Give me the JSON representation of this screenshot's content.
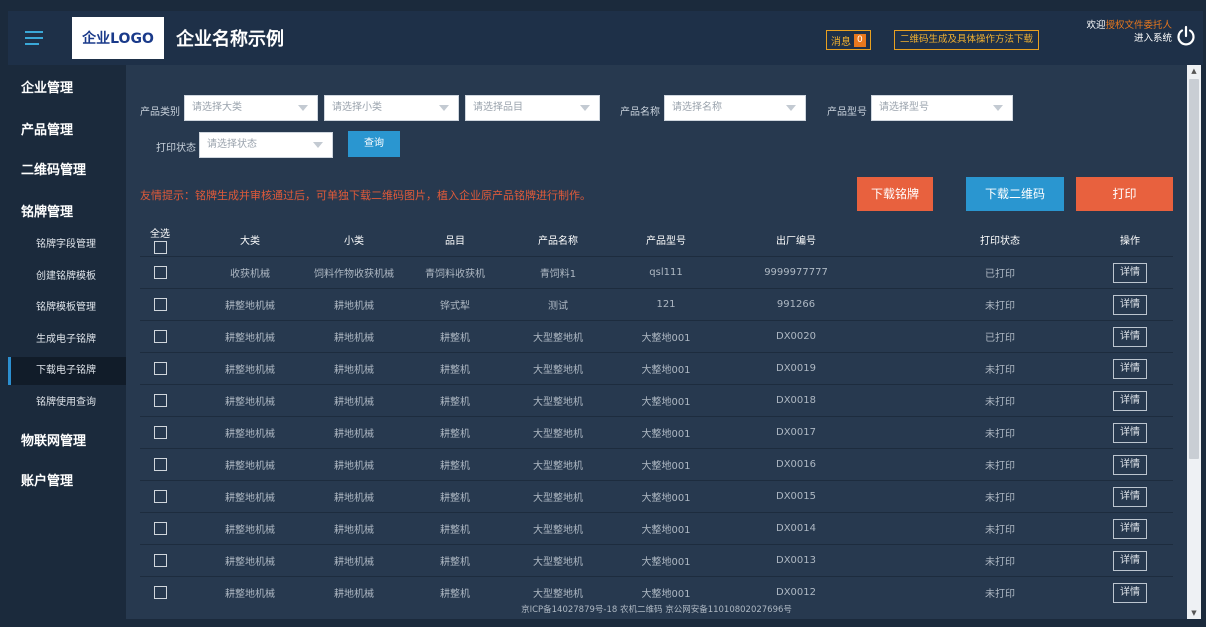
{
  "header": {
    "logo_text": "企业LOGO",
    "company_name": "企业名称示例",
    "message_label": "消息",
    "message_count": "0",
    "guide_button": "二维码生成及具体操作方法下载",
    "welcome_prefix": "欢迎",
    "username": "授权文件委托人",
    "enter_system": "进入系统"
  },
  "sidebar": {
    "groups": [
      "企业管理",
      "产品管理",
      "二维码管理",
      "铭牌管理",
      "物联网管理",
      "账户管理"
    ],
    "items": [
      "铭牌字段管理",
      "创建铭牌模板",
      "铭牌模板管理",
      "生成电子铭牌",
      "下载电子铭牌",
      "铭牌使用查询"
    ],
    "active_item": "下载电子铭牌"
  },
  "filters": {
    "category_label": "产品类别",
    "major_placeholder": "请选择大类",
    "minor_placeholder": "请选择小类",
    "item_placeholder": "请选择品目",
    "name_label": "产品名称",
    "name_placeholder": "请选择名称",
    "model_label": "产品型号",
    "model_placeholder": "请选择型号",
    "status_label": "打印状态",
    "status_placeholder": "请选择状态",
    "query_button": "查询"
  },
  "tip": "友情提示：铭牌生成并审核通过后，可单独下载二维码图片，植入企业原产品铭牌进行制作。",
  "actions": {
    "download_nameplate": "下载铭牌",
    "download_qrcode": "下载二维码",
    "print": "打印"
  },
  "colors": {
    "download_nameplate": "#e8613e",
    "download_qrcode": "#2a96d0",
    "print": "#e8613e"
  },
  "table": {
    "select_all": "全选",
    "columns": [
      "大类",
      "小类",
      "品目",
      "产品名称",
      "产品型号",
      "出厂编号",
      "打印状态",
      "操作"
    ],
    "detail_label": "详情",
    "rows": [
      [
        "收获机械",
        "饲料作物收获机械",
        "青饲料收获机",
        "青饲料1",
        "qsl111",
        "9999977777",
        "已打印"
      ],
      [
        "耕整地机械",
        "耕地机械",
        "铧式犁",
        "测试",
        "121",
        "991266",
        "未打印"
      ],
      [
        "耕整地机械",
        "耕地机械",
        "耕整机",
        "大型整地机",
        "大整地001",
        "DX0020",
        "已打印"
      ],
      [
        "耕整地机械",
        "耕地机械",
        "耕整机",
        "大型整地机",
        "大整地001",
        "DX0019",
        "未打印"
      ],
      [
        "耕整地机械",
        "耕地机械",
        "耕整机",
        "大型整地机",
        "大整地001",
        "DX0018",
        "未打印"
      ],
      [
        "耕整地机械",
        "耕地机械",
        "耕整机",
        "大型整地机",
        "大整地001",
        "DX0017",
        "未打印"
      ],
      [
        "耕整地机械",
        "耕地机械",
        "耕整机",
        "大型整地机",
        "大整地001",
        "DX0016",
        "未打印"
      ],
      [
        "耕整地机械",
        "耕地机械",
        "耕整机",
        "大型整地机",
        "大整地001",
        "DX0015",
        "未打印"
      ],
      [
        "耕整地机械",
        "耕地机械",
        "耕整机",
        "大型整地机",
        "大整地001",
        "DX0014",
        "未打印"
      ],
      [
        "耕整地机械",
        "耕地机械",
        "耕整机",
        "大型整地机",
        "大整地001",
        "DX0013",
        "未打印"
      ],
      [
        "耕整地机械",
        "耕地机械",
        "耕整机",
        "大型整地机",
        "大整地001",
        "DX0012",
        "未打印"
      ]
    ]
  },
  "footer": {
    "line1": "京ICP备14027879号-18 农机二维码 京公网安备11010802027696号"
  }
}
